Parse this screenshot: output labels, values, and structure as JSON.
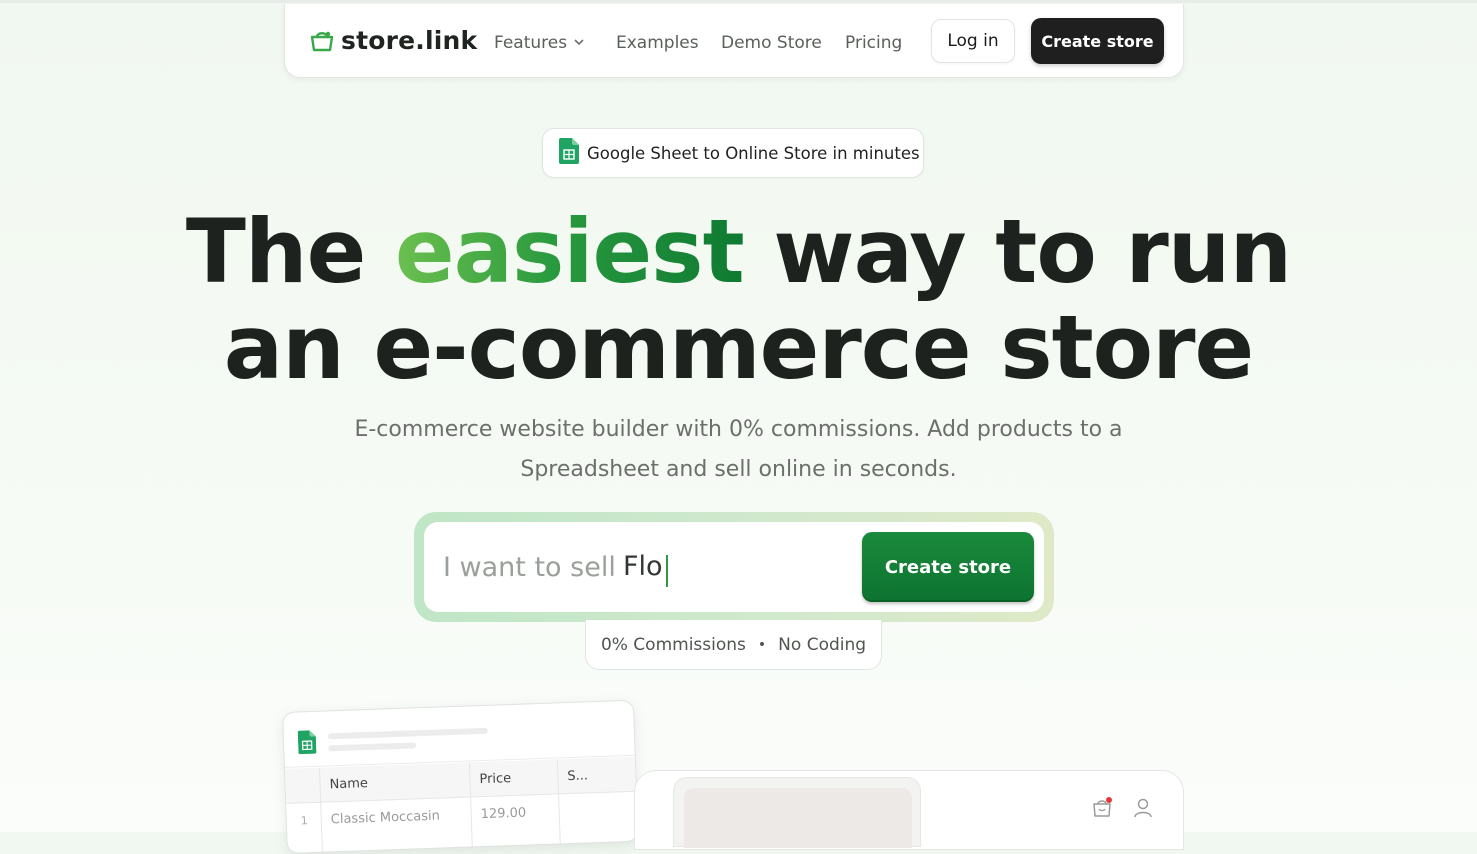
{
  "nav": {
    "logo_text": "store.link",
    "links": [
      {
        "label": "Features"
      },
      {
        "label": "Examples"
      },
      {
        "label": "Demo Store"
      },
      {
        "label": "Pricing"
      }
    ],
    "login_label": "Log in",
    "create_label": "Create store"
  },
  "badge": {
    "text": "Google Sheet to Online Store in minutes",
    "icon": "google-sheets-icon"
  },
  "hero": {
    "headline_part1": "The ",
    "headline_accent": "easiest",
    "headline_part2": " way to run",
    "headline_line2": "an e-commerce store",
    "subtitle": "E-commerce website builder with 0% commissions. Add products to a Spreadsheet and sell online in seconds."
  },
  "search": {
    "prefix": "I want to sell",
    "value": "Flo",
    "button_label": "Create store"
  },
  "features": {
    "item1": "0% Commissions",
    "separator": "•",
    "item2": "No Coding"
  },
  "sheet_preview": {
    "columns": [
      "Name",
      "Price",
      "S..."
    ],
    "rows": [
      {
        "num": "1",
        "name": "Classic Moccasin",
        "price": "129.00"
      }
    ]
  },
  "colors": {
    "accent_green": "#0e7a32",
    "dark_button": "#1f1f1f",
    "logo_green": "#3aa84a"
  }
}
